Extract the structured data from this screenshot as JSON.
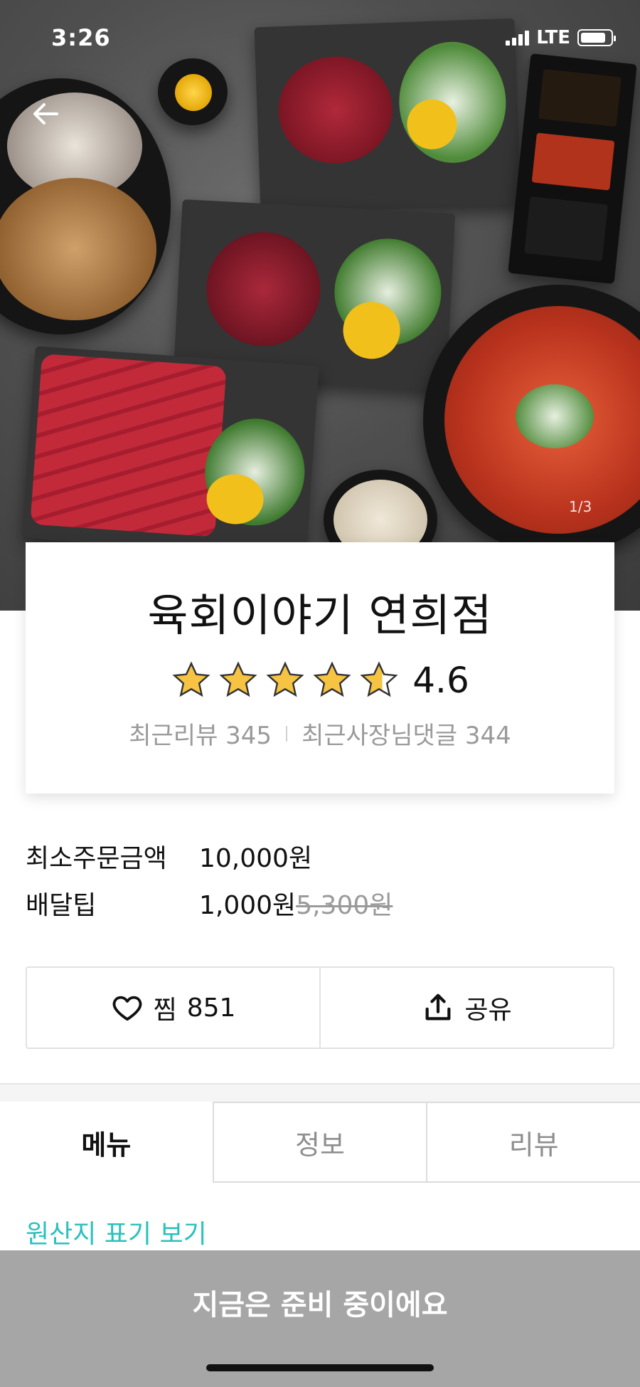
{
  "status_bar": {
    "time": "3:26",
    "network": "LTE"
  },
  "hero": {
    "image_counter": "1/3"
  },
  "store": {
    "name": "육회이야기 연희점",
    "rating": "4.6",
    "rating_value": 4.6,
    "recent_reviews_label": "최근리뷰",
    "recent_reviews_count": "345",
    "owner_replies_label": "최근사장님댓글",
    "owner_replies_count": "344"
  },
  "info": {
    "min_order_label": "최소주문금액",
    "min_order_value": "10,000원",
    "delivery_tip_label": "배달팁",
    "delivery_tip_value": "1,000원",
    "delivery_tip_original": "5,300원"
  },
  "actions": {
    "like_label": "찜",
    "like_count": "851",
    "share_label": "공유"
  },
  "tabs": [
    {
      "label": "메뉴",
      "active": true
    },
    {
      "label": "정보",
      "active": false
    },
    {
      "label": "리뷰",
      "active": false
    }
  ],
  "origin_link": "원산지 표기 보기",
  "bottom_bar": {
    "label": "지금은 준비 중이에요"
  },
  "colors": {
    "accent": "#2ac1bc",
    "star": "#f6c343",
    "bottom_bar": "#a6a6a6"
  },
  "icons": {
    "back": "back-arrow-icon",
    "heart": "heart-icon",
    "share": "share-icon",
    "star": "star-icon"
  }
}
